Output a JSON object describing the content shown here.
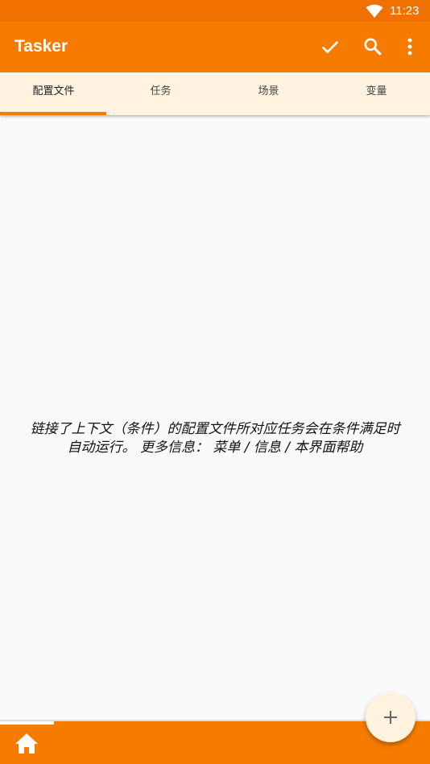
{
  "status_bar": {
    "time": "11:23",
    "wifi_icon": "wifi-icon"
  },
  "app_bar": {
    "title": "Tasker",
    "actions": [
      "check-icon",
      "search-icon",
      "more-vert-icon"
    ]
  },
  "tabs": [
    {
      "label": "配置文件",
      "active": true
    },
    {
      "label": "任务",
      "active": false
    },
    {
      "label": "场景",
      "active": false
    },
    {
      "label": "变量",
      "active": false
    }
  ],
  "main": {
    "empty_message_line1": "链接了上下文（条件）的配置文件所对应任务会在条件满足时",
    "empty_message_line2": "自动运行。 更多信息： 菜单 / 信息 / 本界面帮助"
  },
  "bottom_bar": {
    "home_icon": "home-icon"
  },
  "fab": {
    "icon": "plus-icon"
  },
  "colors": {
    "accent": "#f57c00",
    "status": "#f07000",
    "tab_bg": "#fff3e0"
  }
}
